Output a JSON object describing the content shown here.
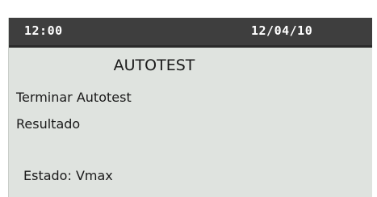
{
  "status_bar": {
    "time": "12:00",
    "date": "12/04/10"
  },
  "screen": {
    "title": "AUTOTEST",
    "menu_items": [
      {
        "label": "Terminar Autotest"
      },
      {
        "label": "Resultado"
      }
    ],
    "status_label": "Estado: Vmax"
  },
  "colors": {
    "status_bar_bg": "#3e3e3e",
    "screen_bg": "#dfe3df",
    "text": "#1a1a1a",
    "status_text": "#ffffff"
  }
}
